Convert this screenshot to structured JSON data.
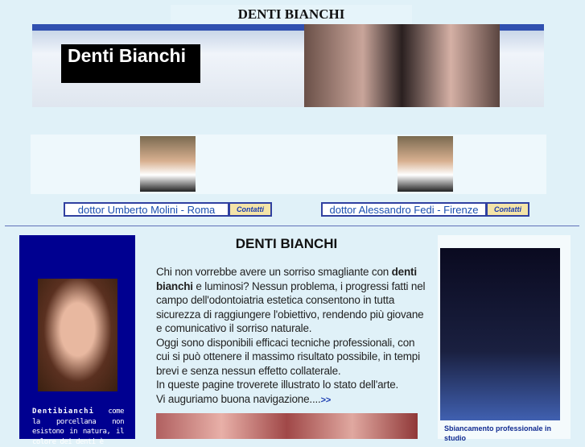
{
  "title": "DENTI BIANCHI",
  "logo": "Denti Bianchi",
  "doctors": [
    {
      "name": "dottor Umberto Molini - Roma",
      "contact": "Contatti"
    },
    {
      "name": "dottor Alessandro Fedi - Firenze",
      "contact": "Contatti"
    }
  ],
  "sidebar_text_bold": "Dentibianchi",
  "sidebar_text": " come la porcellana non esistono in natura, il colore dei denti è",
  "main": {
    "heading": "DENTI BIANCHI",
    "p1a": "Chi non vorrebbe avere un sorriso smagliante con ",
    "p1b": "denti bianchi",
    "p1c": " e luminosi? Nessun problema, i progressi fatti nel campo dell'odontoiatria estetica consentono in tutta sicurezza di raggiungere l'obiettivo, rendendo più giovane e comunicativo il sorriso naturale.",
    "p2": "Oggi sono disponibili efficaci tecniche professionali, con cui si può ottenere il massimo risultato possibile, in tempi brevi e senza nessun effetto collaterale.",
    "p3": "In queste pagine troverete illustrato lo stato dell'arte.",
    "p4": "Vi auguriamo buona navigazione....",
    "more": ">>"
  },
  "right_caption": "Sbiancamento professionale in studio"
}
